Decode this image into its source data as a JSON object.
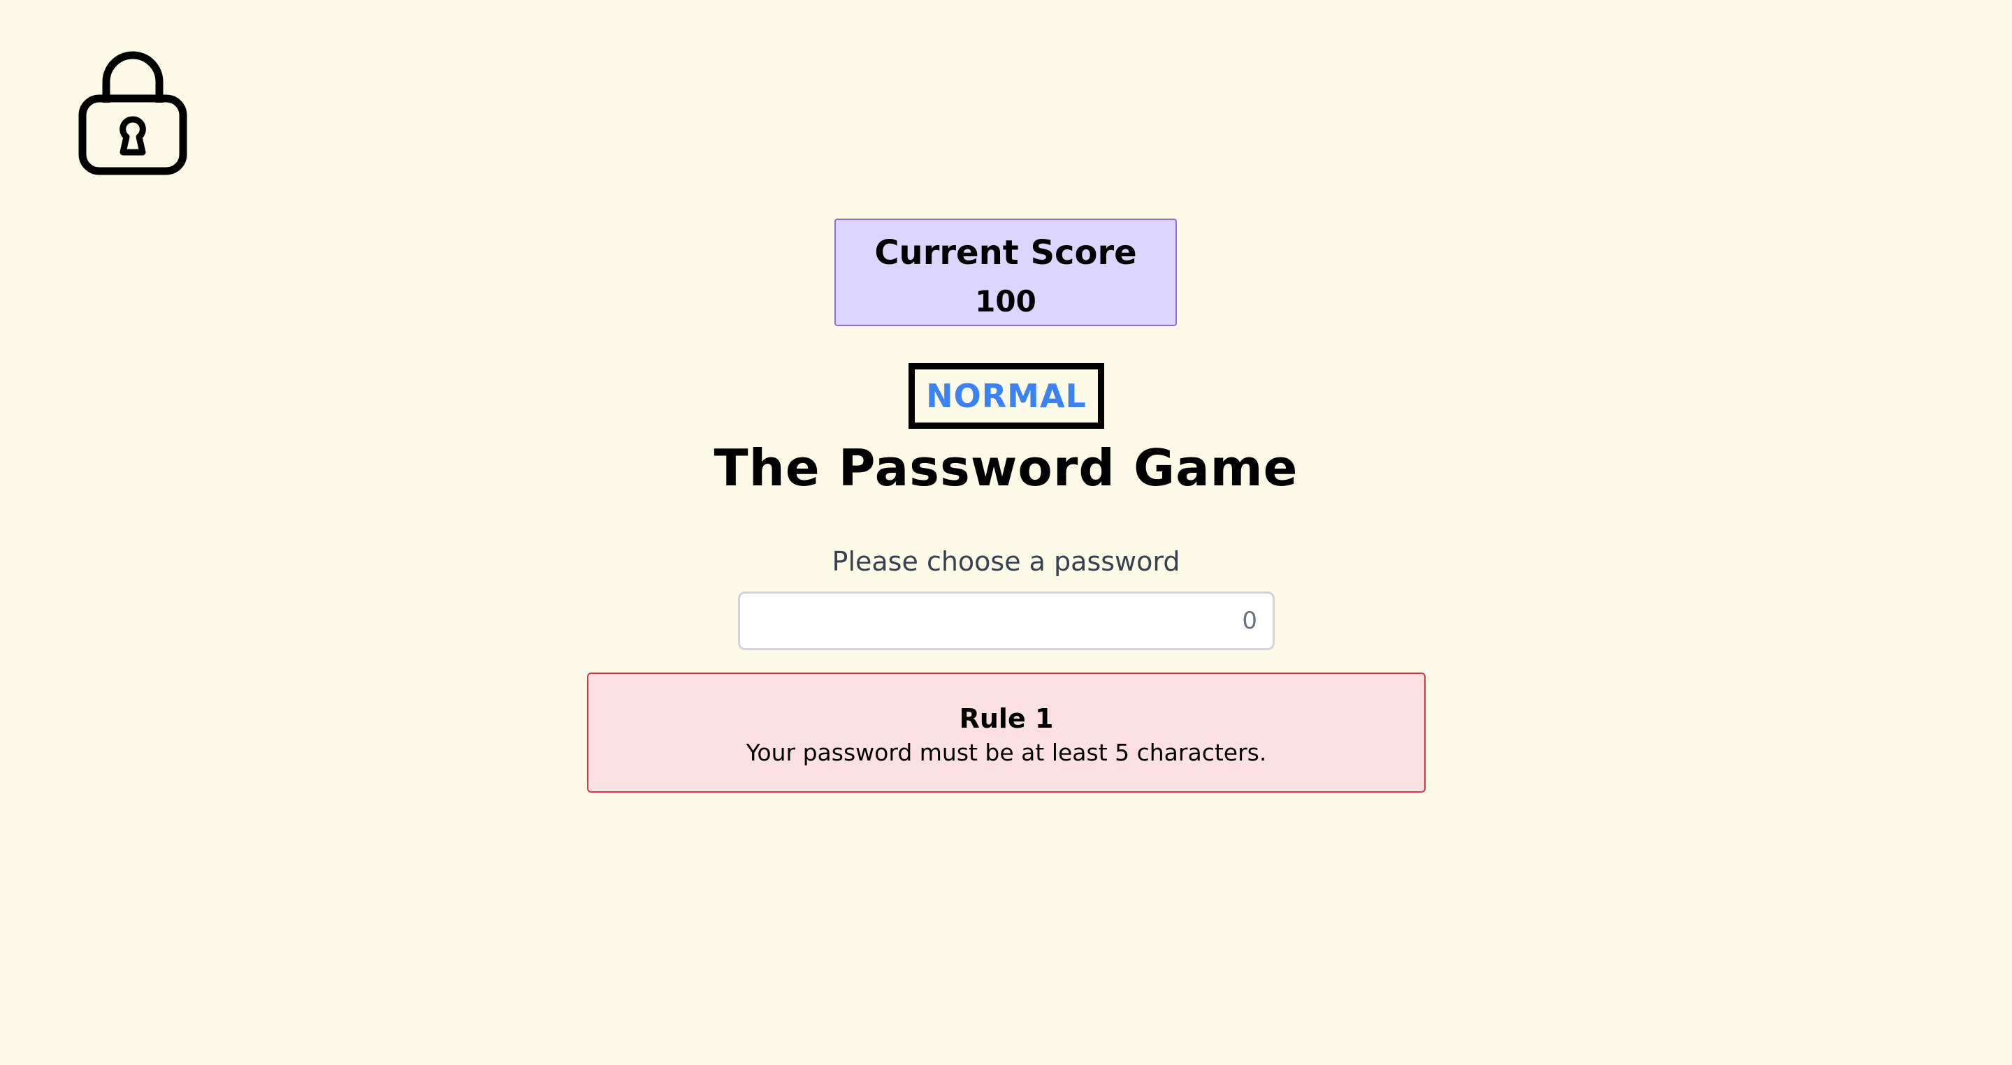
{
  "logo": {
    "icon": "lock-icon"
  },
  "score": {
    "title": "Current Score",
    "value": "100"
  },
  "difficulty": {
    "label": "NORMAL",
    "color": "#3b82f6"
  },
  "title": "The Password Game",
  "password": {
    "prompt": "Please choose a password",
    "value": "",
    "char_count": "0"
  },
  "rules": [
    {
      "title": "Rule 1",
      "text": "Your password must be at least 5 characters.",
      "status": "error"
    }
  ],
  "colors": {
    "background": "#fdfbe8",
    "score_bg": "#dcd6ff",
    "score_border": "#8b6fe0",
    "rule_error_bg": "#fde0e2",
    "rule_error_border": "#e0344a"
  }
}
